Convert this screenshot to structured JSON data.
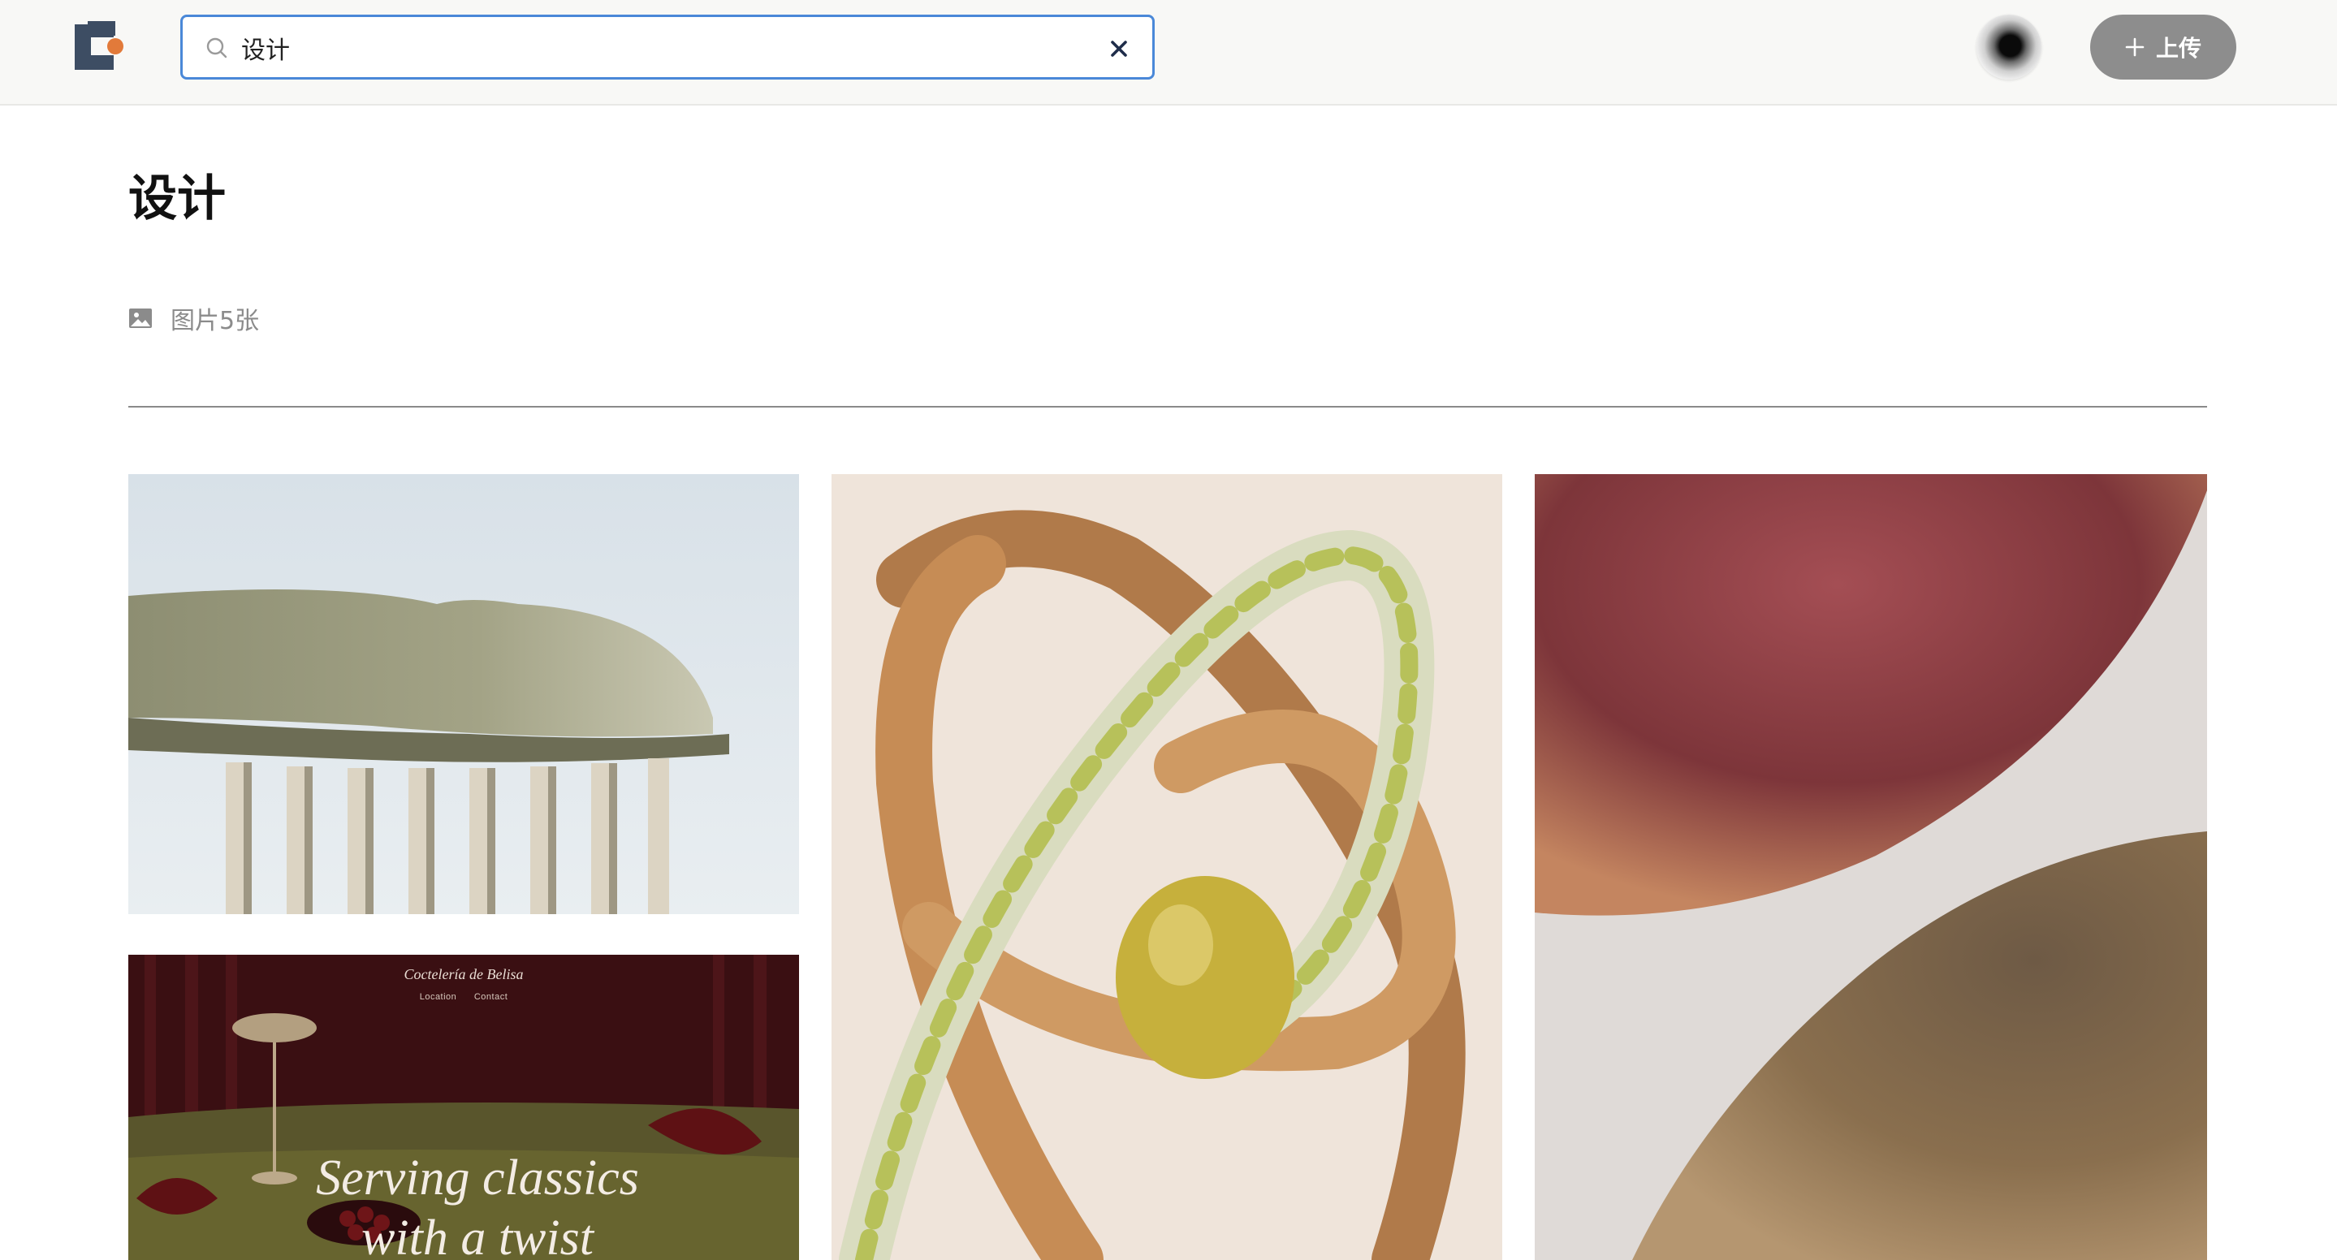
{
  "header": {
    "logo": "app-logo",
    "search": {
      "value": "设计",
      "placeholder": ""
    },
    "avatar": "user-avatar",
    "upload_label": "上传"
  },
  "main": {
    "title": "设计",
    "meta_icon": "image-icon",
    "count_text": "图片5张"
  },
  "gallery": {
    "images": [
      {
        "subject": "architecture-canopy"
      },
      {
        "subject": "intertwined-rings-3d"
      },
      {
        "subject": "metallic-spheres"
      },
      {
        "subject": "cocktail-bar-website",
        "site_name": "Coctelería de Belisa",
        "links": [
          "Location",
          "Contact"
        ],
        "headline": [
          "Serving classics",
          "with a twist"
        ]
      }
    ]
  },
  "colors": {
    "search_border": "#4a88d8",
    "upload_button": "#8d8d8d",
    "logo_dark": "#3d4d63",
    "logo_accent": "#e27a3a"
  }
}
